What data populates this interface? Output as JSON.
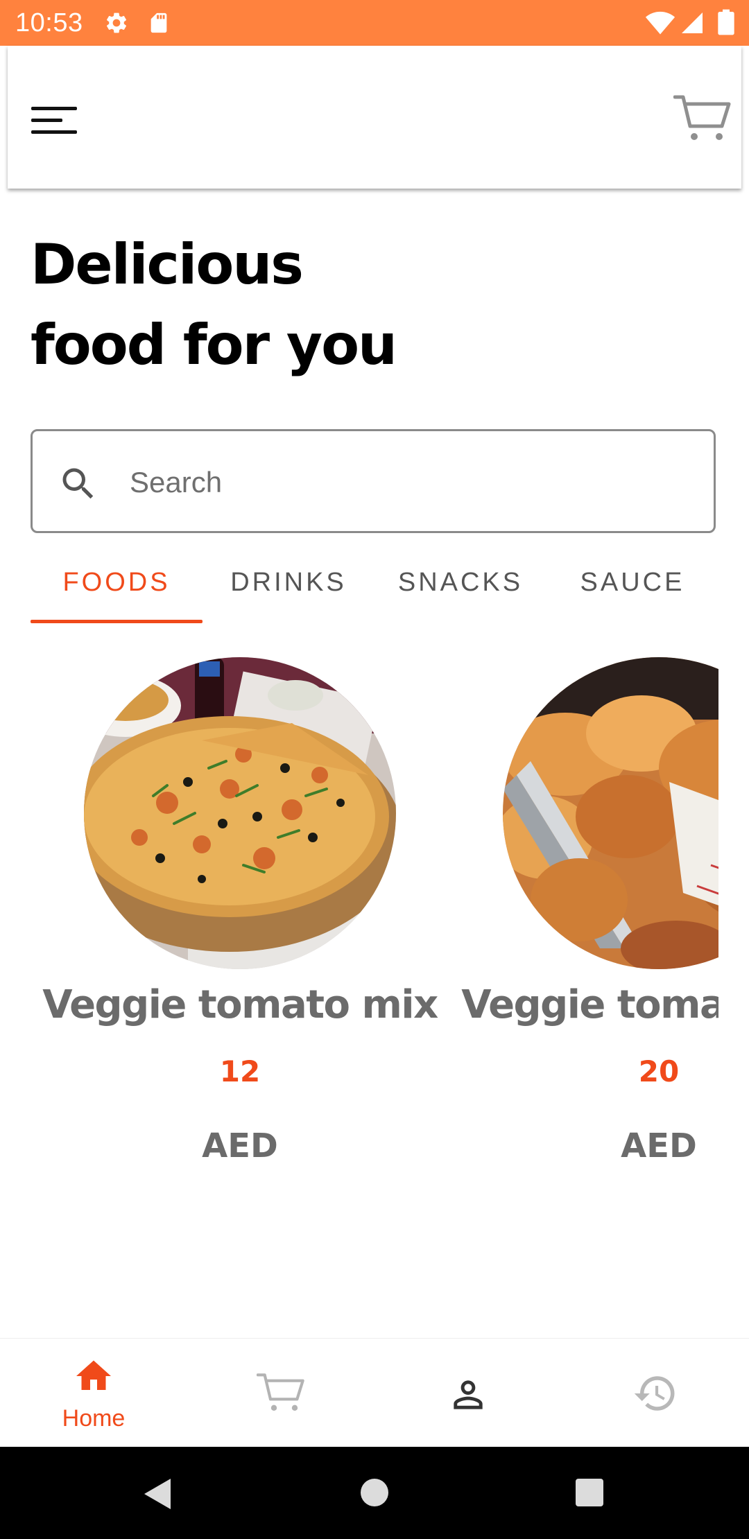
{
  "status_bar": {
    "time": "10:53",
    "background": "#ff823e",
    "icons": [
      "settings-icon",
      "sd-card-icon",
      "wifi-icon",
      "signal-icon",
      "battery-icon"
    ]
  },
  "header": {
    "menu_icon": "hamburger-menu-icon",
    "cart_icon": "shopping-cart-icon"
  },
  "headline": {
    "line1": "Delicious",
    "line2": "food for you"
  },
  "search": {
    "placeholder": "Search",
    "value": "",
    "icon": "search-icon"
  },
  "tabs": [
    {
      "label": "FOODS",
      "active": true
    },
    {
      "label": "DRINKS",
      "active": false
    },
    {
      "label": "SNACKS",
      "active": false
    },
    {
      "label": "SAUCE",
      "active": false
    }
  ],
  "products": [
    {
      "name": "Veggie tomato mix",
      "price": "12",
      "currency": "AED",
      "image": "pizza-photo"
    },
    {
      "name": "Veggie tomato mix",
      "price": "20",
      "currency": "AED",
      "image": "fried-chicken-photo"
    }
  ],
  "bottom_nav": {
    "items": [
      {
        "label": "Home",
        "icon": "home-icon",
        "active": true
      },
      {
        "label": "",
        "icon": "shopping-cart-icon",
        "active": false
      },
      {
        "label": "",
        "icon": "profile-icon",
        "active": false
      },
      {
        "label": "",
        "icon": "history-icon",
        "active": false
      }
    ]
  },
  "system_nav": {
    "buttons": [
      "back-icon",
      "home-circle-icon",
      "recents-square-icon"
    ]
  },
  "colors": {
    "accent": "#f04a1a",
    "status_bar": "#ff823e",
    "text_muted": "#6b6b6b",
    "tab_inactive": "#555555"
  }
}
